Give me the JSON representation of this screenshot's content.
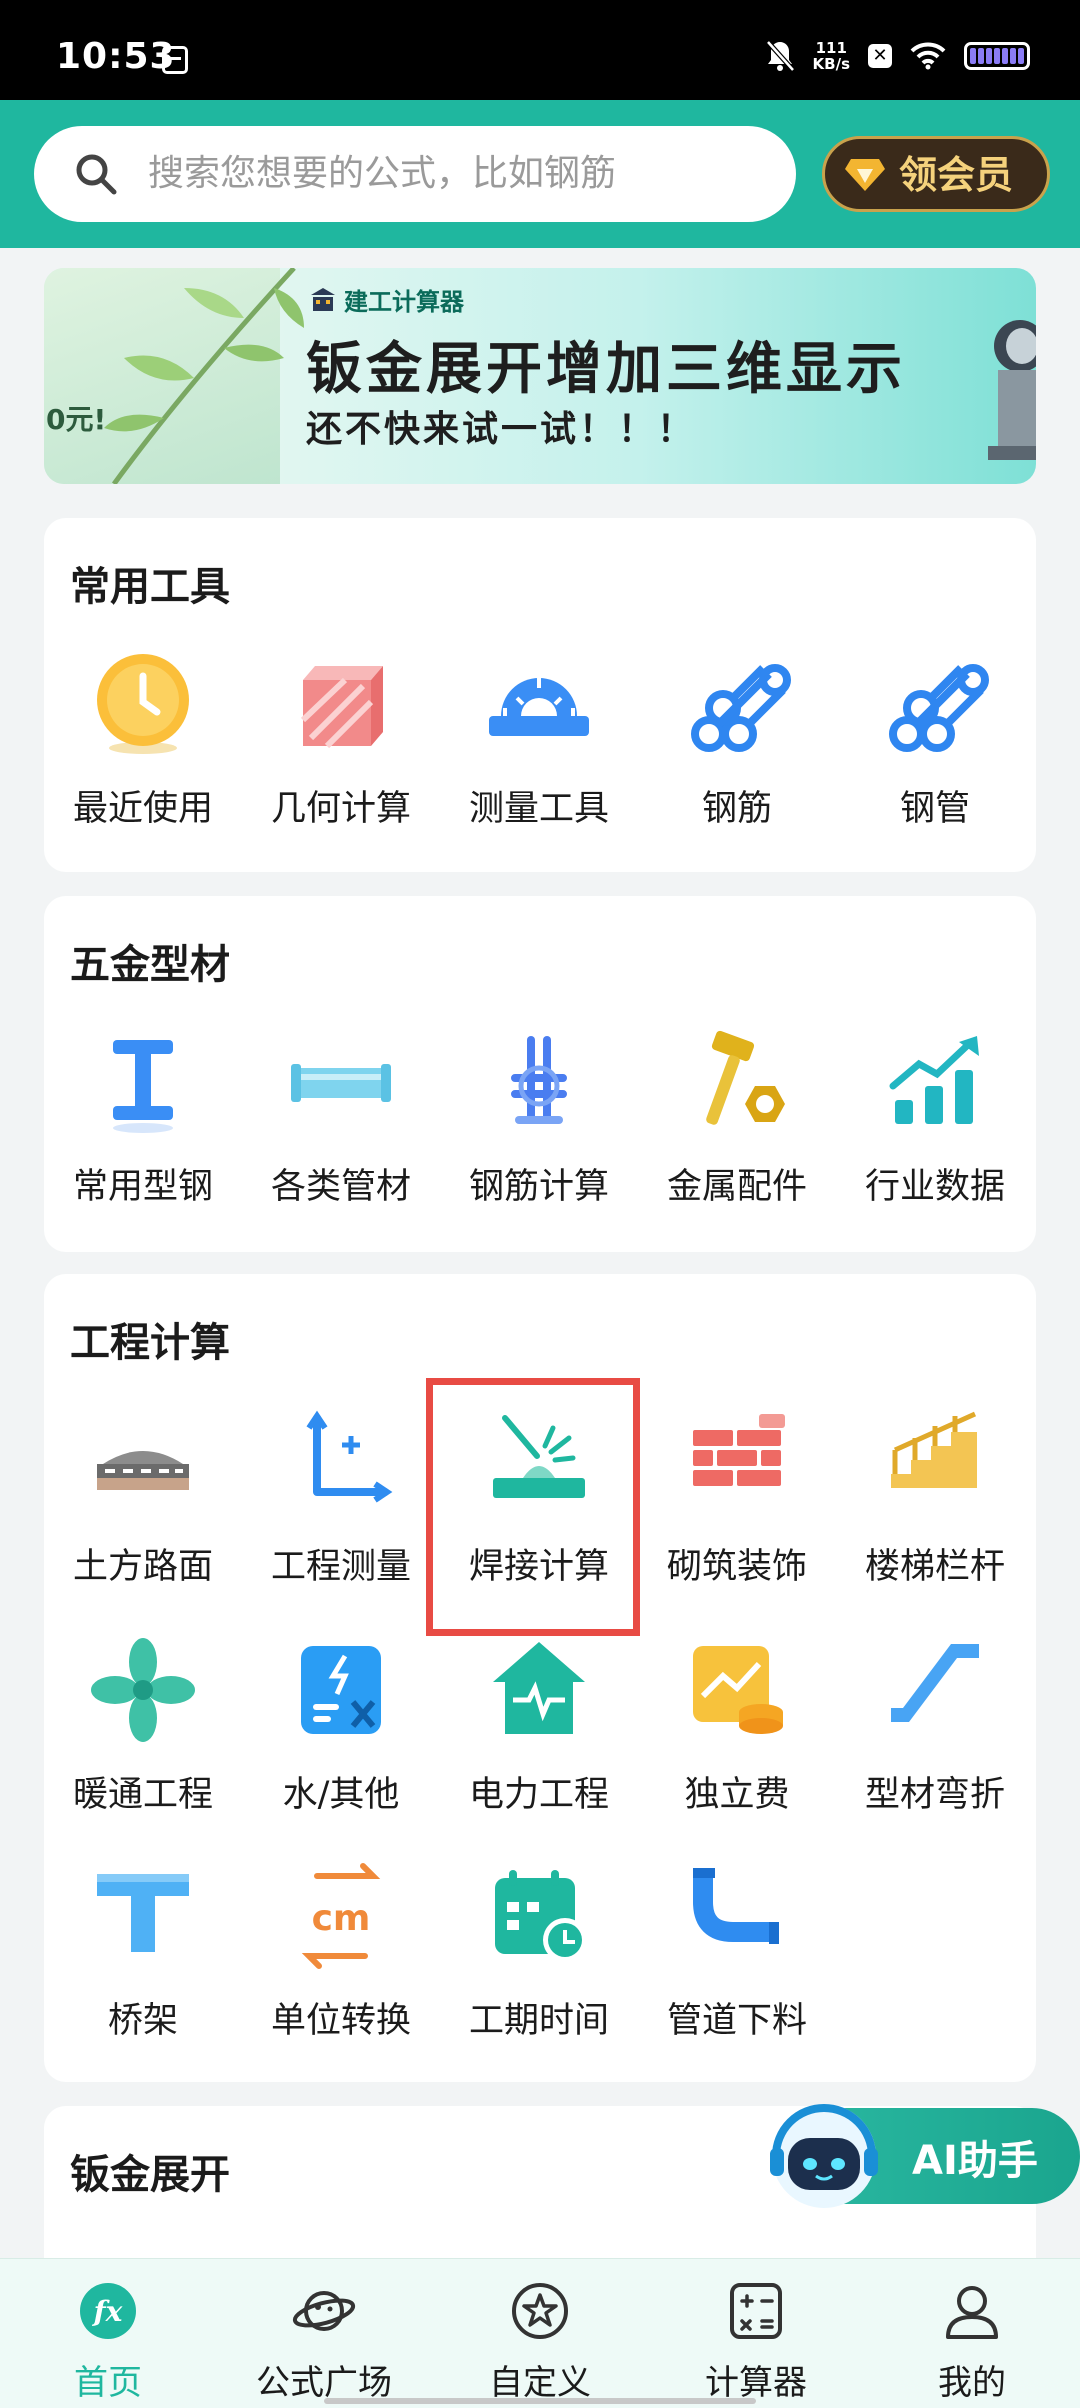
{
  "status_bar": {
    "time": "10:53",
    "net_speed_value": "111",
    "net_speed_unit": "KB/s"
  },
  "header": {
    "search_placeholder": "搜索您想要的公式，比如钢筋",
    "vip_label": "领会员"
  },
  "banner": {
    "left_text": "0元!",
    "brand": "建工计算器",
    "title": "钣金展开增加三维显示",
    "subtitle": "还不快来试一试！！！"
  },
  "sections": {
    "common_tools": {
      "title": "常用工具",
      "items": [
        {
          "label": "最近使用",
          "icon": "clock-icon"
        },
        {
          "label": "几何计算",
          "icon": "cube-icon"
        },
        {
          "label": "测量工具",
          "icon": "protractor-icon"
        },
        {
          "label": "钢筋",
          "icon": "rebar-icon"
        },
        {
          "label": "钢管",
          "icon": "steel-pipe-icon"
        }
      ]
    },
    "hardware": {
      "title": "五金型材",
      "items": [
        {
          "label": "常用型钢",
          "icon": "i-beam-icon"
        },
        {
          "label": "各类管材",
          "icon": "tube-icon"
        },
        {
          "label": "钢筋计算",
          "icon": "rebar-calc-icon"
        },
        {
          "label": "金属配件",
          "icon": "hammer-nut-icon"
        },
        {
          "label": "行业数据",
          "icon": "trend-chart-icon"
        }
      ]
    },
    "engineering": {
      "title": "工程计算",
      "items": [
        {
          "label": "土方路面",
          "icon": "road-paver-icon"
        },
        {
          "label": "工程测量",
          "icon": "axis-measure-icon"
        },
        {
          "label": "焊接计算",
          "icon": "welding-icon"
        },
        {
          "label": "砌筑装饰",
          "icon": "brick-wall-icon"
        },
        {
          "label": "楼梯栏杆",
          "icon": "stairs-icon"
        },
        {
          "label": "暖通工程",
          "icon": "fan-icon"
        },
        {
          "label": "水/其他",
          "icon": "water-tool-icon"
        },
        {
          "label": "电力工程",
          "icon": "power-house-icon"
        },
        {
          "label": "独立费",
          "icon": "fee-coins-icon"
        },
        {
          "label": "型材弯折",
          "icon": "bend-icon"
        },
        {
          "label": "桥架",
          "icon": "tee-tray-icon"
        },
        {
          "label": "单位转换",
          "icon": "unit-convert-icon"
        },
        {
          "label": "工期时间",
          "icon": "calendar-clock-icon"
        },
        {
          "label": "管道下料",
          "icon": "pipe-elbow-icon"
        }
      ]
    },
    "sheet_metal": {
      "title": "钣金展开"
    }
  },
  "ai_assistant": {
    "label": "AI助手"
  },
  "bottom_nav": [
    {
      "label": "首页",
      "icon": "home-fx-icon",
      "active": true
    },
    {
      "label": "公式广场",
      "icon": "planet-icon",
      "active": false
    },
    {
      "label": "自定义",
      "icon": "star-circle-icon",
      "active": false
    },
    {
      "label": "计算器",
      "icon": "calculator-icon",
      "active": false
    },
    {
      "label": "我的",
      "icon": "user-icon",
      "active": false
    }
  ],
  "colors": {
    "accent": "#1fb79f",
    "highlight": "#e84b44",
    "vip_gold": "#f5d27c"
  }
}
